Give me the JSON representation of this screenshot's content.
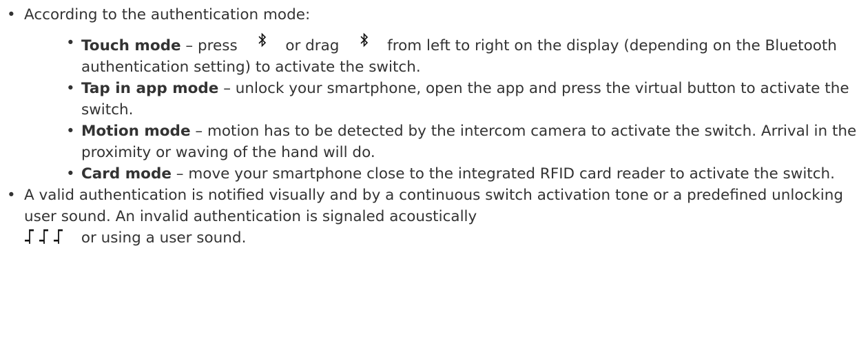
{
  "items": [
    {
      "text": "According to the authentication mode:",
      "subitems": [
        {
          "term": "Touch mode",
          "part1": " – press ",
          "icon1": "bluetooth-icon",
          "part2": " or drag ",
          "icon2": "bluetooth-icon",
          "part3": " from left to right on the display (depending on the Bluetooth authentication setting) to activate the switch."
        },
        {
          "term": "Tap in app mode",
          "text": " – unlock your smartphone, open the app and press the virtual button to activate the switch."
        },
        {
          "term": "Motion mode",
          "text": " – motion has to be detected by the intercom camera to activate the switch. Arrival in the proximity or waving of the hand will do."
        },
        {
          "term": "Card mode",
          "text": " – move your smartphone close to the integrated RFID card reader to activate the switch."
        }
      ]
    },
    {
      "text": "A valid authentication is notified visually and by a continuous switch activation tone or a predefined unlocking user sound. An invalid authentication is signaled acoustically",
      "icon": "invalid-tone-notes-icon",
      "tail": " or using a user sound."
    }
  ],
  "colors": {
    "text": "#333333",
    "background": "#ffffff"
  }
}
